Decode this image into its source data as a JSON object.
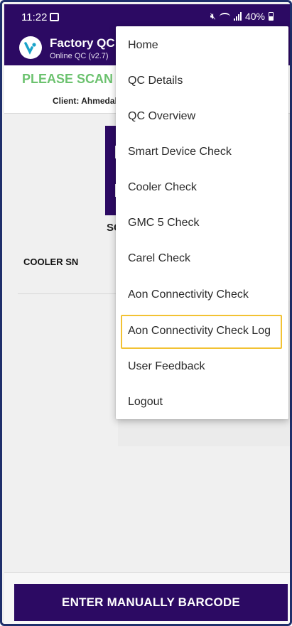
{
  "status_bar": {
    "time": "11:22",
    "battery": "40%",
    "icons": [
      "image-icon",
      "mute-icon",
      "wifi-icon",
      "signal-icon",
      "battery-icon"
    ]
  },
  "app": {
    "title": "Factory QC",
    "subtitle": "Online QC (v2.7)",
    "brand_color": "#2c0a63"
  },
  "scan": {
    "title": "PLEASE SCAN E",
    "title_color": "#6cc26f",
    "client": "Client: Ahmedab",
    "caption": "SC",
    "cooler_sn_label": "COOLER SN"
  },
  "menu": {
    "items": [
      "Home",
      "QC Details",
      "QC Overview",
      "Smart Device Check",
      "Cooler Check",
      "GMC 5 Check",
      "Carel Check",
      "Aon Connectivity Check",
      "Aon Connectivity Check Log",
      "User Feedback",
      "Logout"
    ],
    "highlighted_item": "Aon Connectivity Check Log",
    "highlight_color": "#f2c233"
  },
  "bottom": {
    "button_label": "ENTER MANUALLY BARCODE"
  }
}
